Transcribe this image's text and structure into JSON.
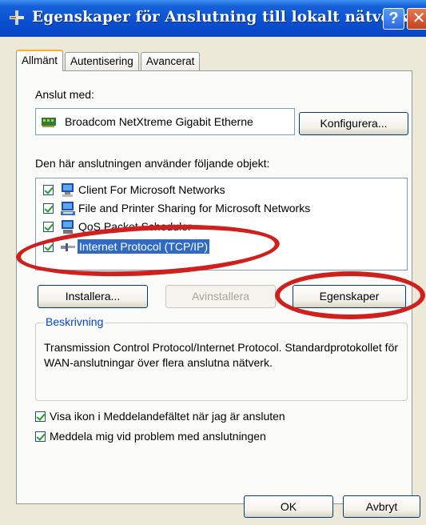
{
  "window": {
    "title": "Egenskaper för Anslutning till lokalt nätverk",
    "help_glyph": "?",
    "close_glyph": "✕"
  },
  "tabs": [
    {
      "label": "Allmänt",
      "active": true
    },
    {
      "label": "Autentisering",
      "active": false
    },
    {
      "label": "Avancerat",
      "active": false
    }
  ],
  "connect_using": {
    "label": "Anslut med:",
    "adapter": "Broadcom NetXtreme Gigabit Etherne",
    "configure_button": "Konfigurera..."
  },
  "components": {
    "label": "Den här anslutningen använder följande objekt:",
    "items": [
      {
        "label": "Client For Microsoft Networks",
        "checked": true,
        "icon": "network-client-icon",
        "selected": false
      },
      {
        "label": "File and Printer Sharing for Microsoft Networks",
        "checked": true,
        "icon": "file-printer-sharing-icon",
        "selected": false
      },
      {
        "label": "QoS Packet Scheduler",
        "checked": true,
        "icon": "qos-scheduler-icon",
        "selected": false
      },
      {
        "label": "Internet Protocol (TCP/IP)",
        "checked": true,
        "icon": "protocol-icon",
        "selected": true
      }
    ]
  },
  "actions": {
    "install": "Installera...",
    "uninstall": "Avinstallera",
    "properties": "Egenskaper"
  },
  "description": {
    "legend": "Beskrivning",
    "text": "Transmission Control Protocol/Internet Protocol. Standardprotokollet för WAN-anslutningar över flera anslutna nätverk."
  },
  "options": [
    {
      "label": "Visa ikon i Meddelandefältet när jag är ansluten",
      "checked": true
    },
    {
      "label": "Meddela mig vid problem med anslutningen",
      "checked": true
    }
  ],
  "footer": {
    "ok": "OK",
    "cancel": "Avbryt"
  },
  "colors": {
    "titlebar": "#0a4fd0",
    "annotation": "#d0201e",
    "selection": "#316ac5",
    "group_legend": "#0046d5"
  }
}
